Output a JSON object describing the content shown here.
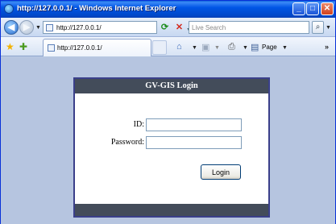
{
  "window": {
    "title": "http://127.0.0.1/ - Windows Internet Explorer"
  },
  "addressbar": {
    "url": "http://127.0.0.1/",
    "search_placeholder": "Live Search"
  },
  "tabs": [
    {
      "label": "http://127.0.0.1/"
    }
  ],
  "toolbar": {
    "page_menu": "Page"
  },
  "login": {
    "title": "GV-GIS Login",
    "id_label": "ID:",
    "password_label": "Password:",
    "id_value": "",
    "password_value": "",
    "button_label": "Login"
  }
}
